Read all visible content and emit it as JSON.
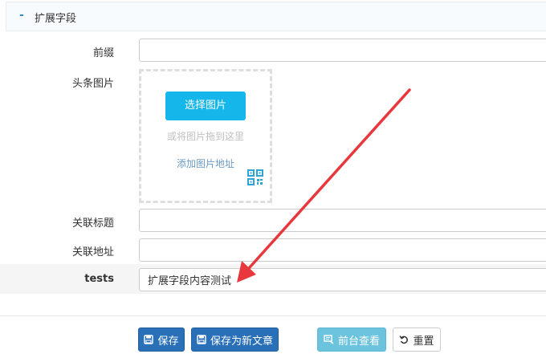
{
  "section": {
    "toggle": "-",
    "title": "扩展字段"
  },
  "fields": {
    "prefix_label": "前缀",
    "prefix_value": "",
    "image_label": "头条图片",
    "related_title_label": "关联标题",
    "related_title_value": "",
    "related_url_label": "关联地址",
    "related_url_value": "",
    "tests_label": "tests",
    "tests_value": "扩展字段内容测试"
  },
  "upload": {
    "select_button": "选择图片",
    "drag_hint": "或将图片拖到这里",
    "add_url_link": "添加图片地址",
    "qr_icon": "qrcode-icon"
  },
  "footer": {
    "save": "保存",
    "save_as_new": "保存为新文章",
    "preview": "前台查看",
    "reset": "重置"
  },
  "colors": {
    "primary": "#2a70b8",
    "upload_button": "#15b6ea",
    "preview_button": "#6cc3de",
    "annotation_arrow": "#e8383d"
  }
}
